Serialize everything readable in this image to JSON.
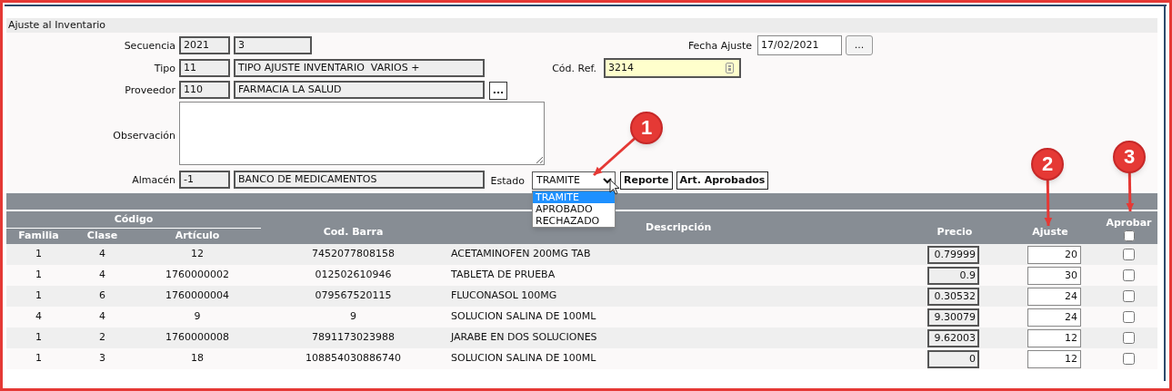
{
  "window": {
    "title": "Ajuste al Inventario"
  },
  "form": {
    "secuencia": {
      "label": "Secuencia",
      "code": "2021",
      "value": "3"
    },
    "tipo": {
      "label": "Tipo",
      "code": "11",
      "value": "TIPO AJUSTE INVENTARIO  VARIOS +"
    },
    "proveedor": {
      "label": "Proveedor",
      "code": "110",
      "value": "FARMACIA LA SALUD",
      "button": "..."
    },
    "observacion": {
      "label": "Observación"
    },
    "almacen": {
      "label": "Almacén",
      "code": "-1",
      "value": "BANCO DE MEDICAMENTOS"
    },
    "fecha_ajuste": {
      "label": "Fecha Ajuste",
      "value": "17/02/2021",
      "button": "..."
    },
    "cod_ref": {
      "label": "Cód. Ref.",
      "value": "3214"
    },
    "estado": {
      "label": "Estado",
      "value": "TRAMITE",
      "expanded": true,
      "options": [
        {
          "label": "TRAMITE",
          "selected": true
        },
        {
          "label": "APROBADO",
          "selected": false
        },
        {
          "label": "RECHAZADO",
          "selected": false
        }
      ]
    },
    "buttons": [
      "Reporte",
      "Art. Aprobados"
    ]
  },
  "table": {
    "group_header": "Código",
    "columns": [
      "Familia",
      "Clase",
      "Artículo",
      "Cod. Barra",
      "Descripción",
      "Precio",
      "Ajuste",
      "Aprobar"
    ],
    "select_all_checked": false,
    "rows": [
      {
        "familia": "1",
        "clase": "4",
        "articulo": "12",
        "cod_barra": "7452077808158",
        "descripcion": "ACETAMINOFEN 200MG TAB",
        "precio": "0.79999",
        "ajuste": "20",
        "aprobar": false
      },
      {
        "familia": "1",
        "clase": "4",
        "articulo": "1760000002",
        "cod_barra": "012502610946",
        "descripcion": "TABLETA DE PRUEBA",
        "precio": "0.9",
        "ajuste": "30",
        "aprobar": false
      },
      {
        "familia": "1",
        "clase": "6",
        "articulo": "1760000004",
        "cod_barra": "079567520115",
        "descripcion": "FLUCONASOL 100MG",
        "precio": "0.30532",
        "ajuste": "24",
        "aprobar": false
      },
      {
        "familia": "4",
        "clase": "4",
        "articulo": "9",
        "cod_barra": "9",
        "descripcion": "SOLUCION SALINA DE 100ML",
        "precio": "9.30079",
        "ajuste": "24",
        "aprobar": false
      },
      {
        "familia": "1",
        "clase": "2",
        "articulo": "1760000008",
        "cod_barra": "7891173023988",
        "descripcion": "JARABE EN DOS SOLUCIONES",
        "precio": "9.62003",
        "ajuste": "12",
        "aprobar": false
      },
      {
        "familia": "1",
        "clase": "3",
        "articulo": "18",
        "cod_barra": "108854030886740",
        "descripcion": "SOLUCION SALINA DE 100ML",
        "precio": "0",
        "ajuste": "12",
        "aprobar": false
      }
    ]
  },
  "callouts": [
    "1",
    "2",
    "3"
  ]
}
